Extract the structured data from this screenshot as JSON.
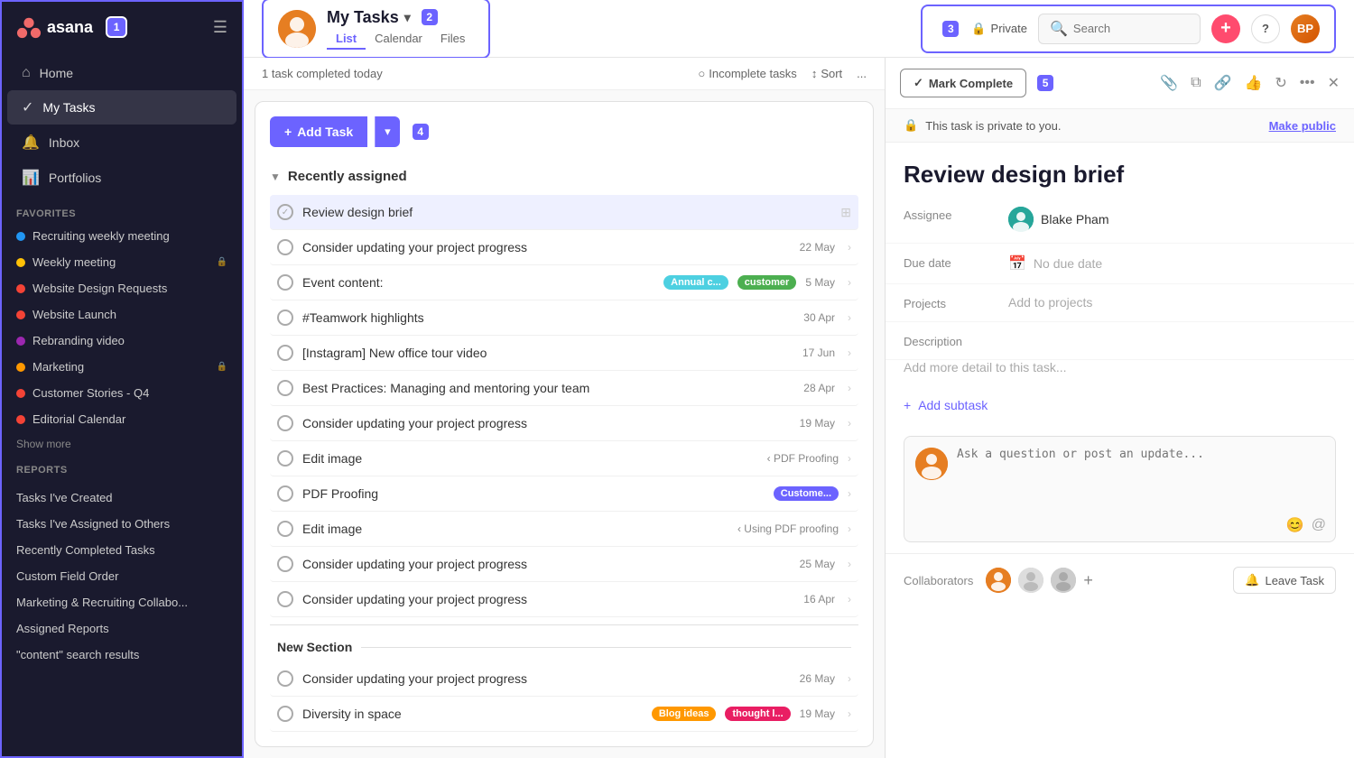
{
  "sidebar": {
    "logo_text": "asana",
    "badge1": "1",
    "nav": [
      {
        "label": "Home",
        "icon": "⌂",
        "active": false
      },
      {
        "label": "My Tasks",
        "icon": "✓",
        "active": true
      },
      {
        "label": "Inbox",
        "icon": "🔔",
        "active": false
      },
      {
        "label": "Portfolios",
        "icon": "📊",
        "active": false
      }
    ],
    "favorites_title": "Favorites",
    "favorites": [
      {
        "label": "Recruiting weekly meeting",
        "color": "#2196f3",
        "lock": false
      },
      {
        "label": "Weekly meeting",
        "color": "#ffc107",
        "lock": true
      },
      {
        "label": "Website Design Requests",
        "color": "#f44336",
        "lock": false
      },
      {
        "label": "Website Launch",
        "color": "#f44336",
        "lock": false
      },
      {
        "label": "Rebranding video",
        "color": "#9c27b0",
        "lock": false
      },
      {
        "label": "Marketing",
        "color": "#ff9800",
        "lock": true
      },
      {
        "label": "Customer Stories - Q4",
        "color": "#f44336",
        "lock": false
      },
      {
        "label": "Editorial Calendar",
        "color": "#f44336",
        "lock": false
      }
    ],
    "show_more": "Show more",
    "reports_title": "Reports",
    "reports": [
      {
        "label": "Tasks I've Created"
      },
      {
        "label": "Tasks I've Assigned to Others"
      },
      {
        "label": "Recently Completed Tasks"
      },
      {
        "label": "Custom Field Order"
      },
      {
        "label": "Marketing & Recruiting Collabo..."
      },
      {
        "label": "Assigned Reports"
      },
      {
        "label": "\"content\" search results"
      }
    ]
  },
  "header": {
    "avatar_initials": "BP",
    "title": "My Tasks",
    "badge2": "2",
    "tabs": [
      {
        "label": "List",
        "active": true
      },
      {
        "label": "Calendar",
        "active": false
      },
      {
        "label": "Files",
        "active": false
      }
    ],
    "badge3": "3",
    "private_label": "Private",
    "search_placeholder": "Search",
    "add_btn": "+",
    "help_btn": "?",
    "user_initials": "BP"
  },
  "task_list": {
    "status_text": "1 task completed today",
    "incomplete_tasks": "Incomplete tasks",
    "sort": "Sort",
    "more": "...",
    "add_task_label": "+ Add Task",
    "add_task_badge": "4",
    "section_recently": "Recently assigned",
    "tasks_recently": [
      {
        "name": "Review design brief",
        "date": "",
        "tags": [],
        "breadcrumb": "",
        "selected": true
      },
      {
        "name": "Consider updating your project progress",
        "date": "22 May",
        "tags": [],
        "breadcrumb": ""
      },
      {
        "name": "Event content:",
        "date": "5 May",
        "tags": [
          "Annual c...",
          "customer"
        ],
        "breadcrumb": ""
      },
      {
        "name": "#Teamwork highlights",
        "date": "30 Apr",
        "tags": [],
        "breadcrumb": ""
      },
      {
        "name": "[Instagram] New office tour video",
        "date": "17 Jun",
        "tags": [],
        "breadcrumb": ""
      },
      {
        "name": "Best Practices: Managing and mentoring your team",
        "date": "28 Apr",
        "tags": [],
        "breadcrumb": ""
      },
      {
        "name": "Consider updating your project progress",
        "date": "19 May",
        "tags": [],
        "breadcrumb": ""
      },
      {
        "name": "Edit image",
        "date": "",
        "tags": [],
        "breadcrumb": "< PDF Proofing"
      },
      {
        "name": "PDF Proofing",
        "date": "",
        "tags": [
          "Custome..."
        ],
        "breadcrumb": ""
      },
      {
        "name": "Edit image",
        "date": "",
        "tags": [],
        "breadcrumb": "< Using PDF proofing"
      },
      {
        "name": "Consider updating your project progress",
        "date": "25 May",
        "tags": [],
        "breadcrumb": ""
      },
      {
        "name": "Consider updating your project progress",
        "date": "16 Apr",
        "tags": [],
        "breadcrumb": ""
      }
    ],
    "section_new": "New Section",
    "tasks_new": [
      {
        "name": "Consider updating your project progress",
        "date": "26 May",
        "tags": [],
        "breadcrumb": ""
      },
      {
        "name": "Diversity in space",
        "date": "19 May",
        "tags": [
          "Blog ideas",
          "thought l..."
        ],
        "breadcrumb": ""
      }
    ]
  },
  "detail": {
    "mark_complete": "Mark Complete",
    "badge5": "5",
    "private_msg": "This task is private to you.",
    "make_public": "Make public",
    "task_title": "Review design brief",
    "assignee_label": "Assignee",
    "assignee_name": "Blake Pham",
    "assignee_initials": "BP",
    "due_date_label": "Due date",
    "due_date_value": "No due date",
    "projects_label": "Projects",
    "projects_value": "Add to projects",
    "description_label": "Description",
    "description_placeholder": "Add more detail to this task...",
    "add_subtask": "+ Add subtask",
    "comment_placeholder": "Ask a question or post an update...",
    "collaborators_label": "Collaborators",
    "leave_task": "Leave Task"
  }
}
